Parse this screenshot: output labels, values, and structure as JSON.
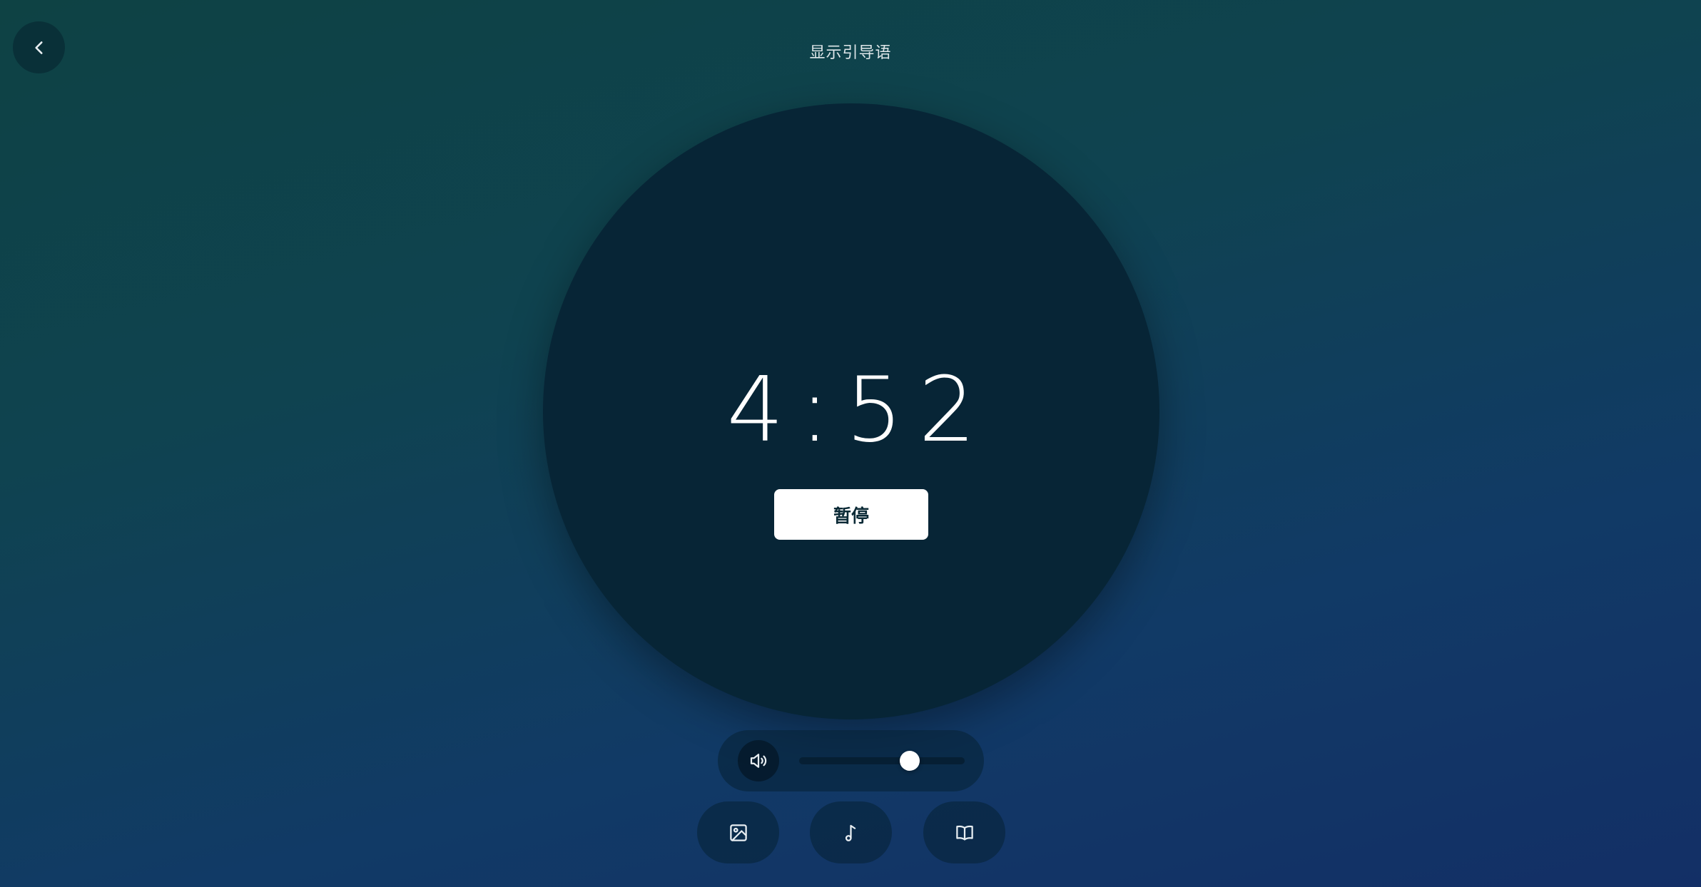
{
  "header": {
    "guide_toggle_label": "显示引导语"
  },
  "timer": {
    "display": "4:52",
    "pause_label": "暂停"
  },
  "volume": {
    "level": 0.67
  },
  "toolbar": {
    "buttons": [
      {
        "icon": "image-icon"
      },
      {
        "icon": "music-note-icon"
      },
      {
        "icon": "book-icon"
      }
    ]
  },
  "colors": {
    "circle": "#072536",
    "button_bg": "#ffffff",
    "button_text": "#0b2a36"
  }
}
